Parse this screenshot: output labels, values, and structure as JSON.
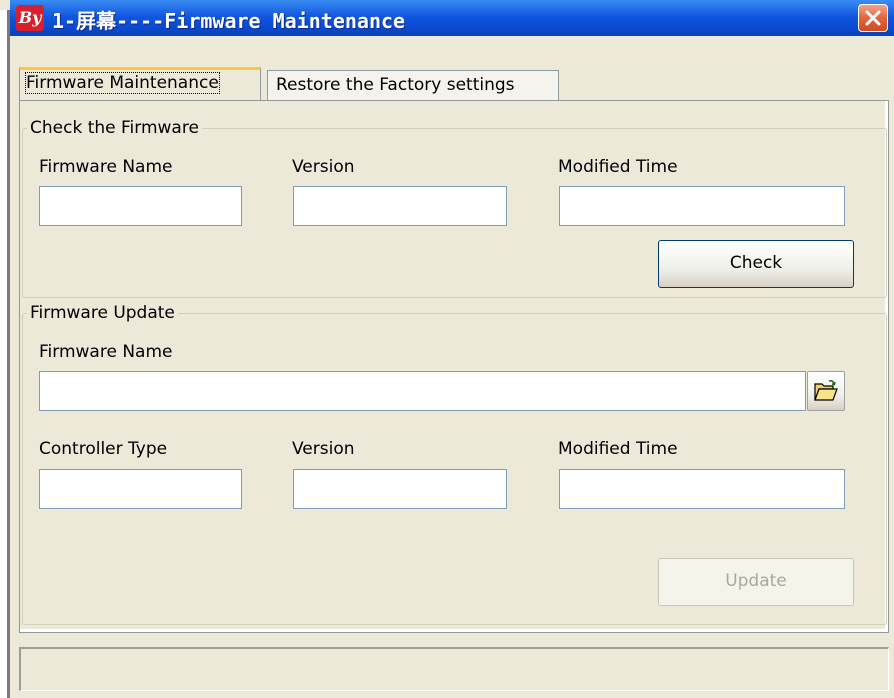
{
  "window": {
    "logo_text": "By",
    "title": "1-屏幕----Firmware Maintenance"
  },
  "tabs": [
    {
      "label": "Firmware Maintenance",
      "active": true
    },
    {
      "label": "Restore the Factory settings",
      "active": false
    }
  ],
  "check_group": {
    "legend": "Check the Firmware",
    "firmware_name_label": "Firmware Name",
    "version_label": "Version",
    "modified_time_label": "Modified Time",
    "firmware_name_value": "",
    "version_value": "",
    "modified_time_value": "",
    "check_button": "Check"
  },
  "update_group": {
    "legend": "Firmware Update",
    "firmware_name_label": "Firmware Name",
    "firmware_path_value": "",
    "controller_type_label": "Controller Type",
    "version_label": "Version",
    "modified_time_label": "Modified Time",
    "controller_type_value": "",
    "version_value": "",
    "modified_time_value": "",
    "update_button": "Update",
    "update_button_enabled": false
  },
  "status_bar": {
    "text": ""
  },
  "icons": {
    "logo": "app-logo-icon",
    "close": "close-icon",
    "browse": "open-folder-icon"
  },
  "colors": {
    "titlebar": "#0a48cf",
    "close_button": "#e0663e",
    "tab_highlight": "#ffc83c",
    "dialog_bg": "#ece9d8"
  }
}
